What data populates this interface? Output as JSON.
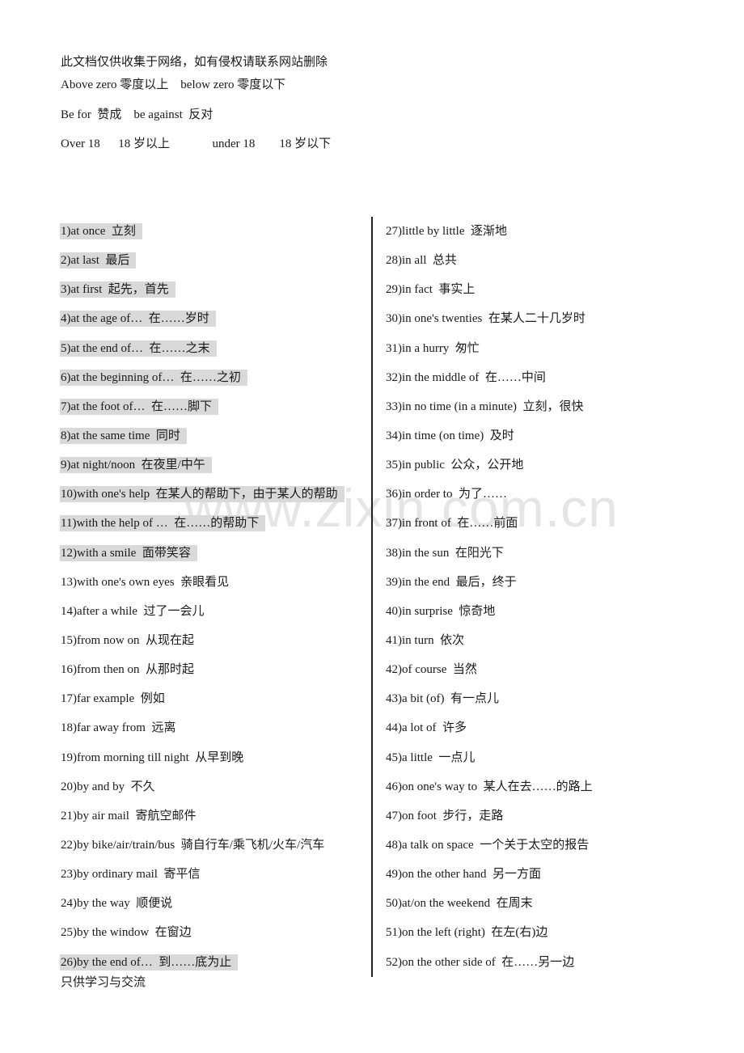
{
  "header": {
    "disclaimer": "此文档仅供收集于网络，如有侵权请联系网站删除",
    "lines": [
      "Above zero 零度以上    below zero 零度以下",
      "Be for  赞成    be against  反对",
      "Over 18      18 岁以上              under 18        18 岁以下"
    ]
  },
  "watermark": "www.zixin.com.cn",
  "footer": "只供学习与交流",
  "colors": {
    "highlight": "#d9d9d9",
    "text": "#1a1a1a",
    "divider": "#222222"
  },
  "left_column": [
    {
      "text": "1)at once  立刻",
      "highlighted": true
    },
    {
      "text": "2)at last  最后",
      "highlighted": true
    },
    {
      "text": "3)at first  起先，首先",
      "highlighted": true
    },
    {
      "text": "4)at the age of…  在……岁时",
      "highlighted": true
    },
    {
      "text": "5)at the end of…  在……之末",
      "highlighted": true
    },
    {
      "text": "6)at the beginning of…  在……之初",
      "highlighted": true
    },
    {
      "text": "7)at the foot of…  在……脚下",
      "highlighted": true
    },
    {
      "text": "8)at the same time  同时",
      "highlighted": true
    },
    {
      "text": "9)at night/noon  在夜里/中午",
      "highlighted": true
    },
    {
      "text": "10)with one's help  在某人的帮助下，由于某人的帮助",
      "highlighted": true
    },
    {
      "text": "11)with the help of …  在……的帮助下",
      "highlighted": true
    },
    {
      "text": "12)with a smile  面带笑容",
      "highlighted": true
    },
    {
      "text": "13)with one's own eyes  亲眼看见",
      "highlighted": false
    },
    {
      "text": "14)after a while  过了一会儿",
      "highlighted": false
    },
    {
      "text": "15)from now on  从现在起",
      "highlighted": false
    },
    {
      "text": "16)from then on  从那时起",
      "highlighted": false
    },
    {
      "text": "17)far example  例如",
      "highlighted": false
    },
    {
      "text": "18)far away from  远离",
      "highlighted": false
    },
    {
      "text": "19)from morning till night  从早到晚",
      "highlighted": false
    },
    {
      "text": "20)by and by  不久",
      "highlighted": false
    },
    {
      "text": "21)by air mail  寄航空邮件",
      "highlighted": false
    },
    {
      "text": "22)by bike/air/train/bus  骑自行车/乘飞机/火车/汽车",
      "highlighted": false
    },
    {
      "text": "23)by ordinary mail  寄平信",
      "highlighted": false
    },
    {
      "text": "24)by the way  顺便说",
      "highlighted": false
    },
    {
      "text": "25)by the window  在窗边",
      "highlighted": false
    },
    {
      "text": "26)by the end of…  到……底为止",
      "highlighted": true
    }
  ],
  "right_column": [
    {
      "text": "27)little by little  逐渐地",
      "highlighted": false
    },
    {
      "text": "28)in all  总共",
      "highlighted": false
    },
    {
      "text": "29)in fact  事实上",
      "highlighted": false
    },
    {
      "text": "30)in one's twenties  在某人二十几岁时",
      "highlighted": false
    },
    {
      "text": "31)in a hurry  匆忙",
      "highlighted": false
    },
    {
      "text": "32)in the middle of  在……中间",
      "highlighted": false
    },
    {
      "text": "33)in no time (in a minute)  立刻，很快",
      "highlighted": false
    },
    {
      "text": "34)in time (on time)  及时",
      "highlighted": false
    },
    {
      "text": "35)in public  公众，公开地",
      "highlighted": false
    },
    {
      "text": "36)in order to  为了……",
      "highlighted": false
    },
    {
      "text": "37)in front of  在……前面",
      "highlighted": false
    },
    {
      "text": "38)in the sun  在阳光下",
      "highlighted": false
    },
    {
      "text": "39)in the end  最后，终于",
      "highlighted": false
    },
    {
      "text": "40)in surprise  惊奇地",
      "highlighted": false
    },
    {
      "text": "41)in turn  依次",
      "highlighted": false
    },
    {
      "text": "42)of course  当然",
      "highlighted": false
    },
    {
      "text": "43)a bit (of)  有一点儿",
      "highlighted": false
    },
    {
      "text": "44)a lot of  许多",
      "highlighted": false
    },
    {
      "text": "45)a little  一点儿",
      "highlighted": false
    },
    {
      "text": "46)on one's way to  某人在去……的路上",
      "highlighted": false
    },
    {
      "text": "47)on foot  步行，走路",
      "highlighted": false
    },
    {
      "text": "48)a talk on space  一个关于太空的报告",
      "highlighted": false
    },
    {
      "text": "49)on the other hand  另一方面",
      "highlighted": false
    },
    {
      "text": "50)at/on the weekend  在周末",
      "highlighted": false
    },
    {
      "text": "51)on the left (right)  在左(右)边",
      "highlighted": false
    },
    {
      "text": "52)on the other side of  在……另一边",
      "highlighted": false
    }
  ]
}
